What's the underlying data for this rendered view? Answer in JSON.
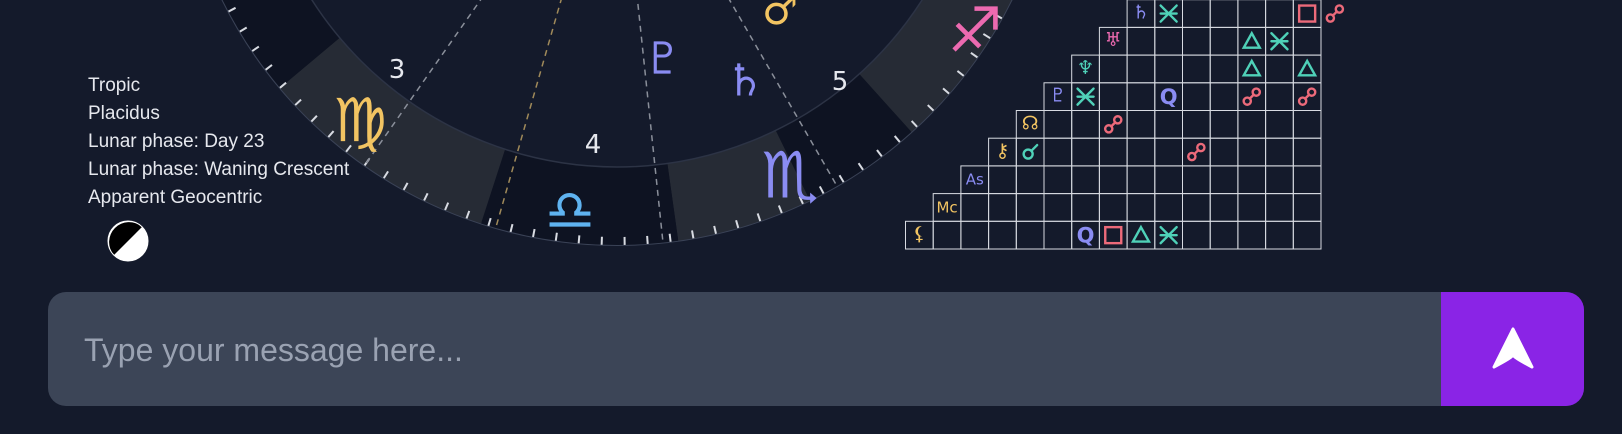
{
  "chart_info": {
    "lines": [
      "Tropic",
      "Placidus",
      "Lunar phase: Day 23",
      "Lunar phase: Waning Crescent",
      "Apparent Geocentric"
    ],
    "moon_phase_icon": "waning-crescent-moon-icon"
  },
  "wheel": {
    "houses": [
      {
        "number": "3",
        "sign": "♍",
        "sign_name": "virgo",
        "color": "#f2c462"
      },
      {
        "number": "4",
        "sign": "♎",
        "sign_name": "libra",
        "color": "#5fb3f0"
      },
      {
        "number": "5",
        "sign": "♏",
        "sign_name": "scorpio",
        "color": "#8a8cf2"
      },
      {
        "number": "",
        "sign": "♐",
        "sign_name": "sagittarius",
        "color": "#ec6ab0"
      }
    ],
    "planets": [
      {
        "glyph": "♇",
        "name": "pluto",
        "color": "#8a8cf2"
      },
      {
        "glyph": "♄",
        "name": "saturn",
        "color": "#8a8cf2"
      },
      {
        "glyph": "♂",
        "name": "mars",
        "color": "#f2c462"
      }
    ]
  },
  "aspect_grid": {
    "rows": [
      {
        "glyph": "♄",
        "color": "#8a8cf2"
      },
      {
        "glyph": "♅",
        "color": "#ec6ab0"
      },
      {
        "glyph": "♆",
        "color": "#4fd1b8"
      },
      {
        "glyph": "♇",
        "color": "#8a8cf2"
      },
      {
        "glyph": "☊",
        "color": "#f2c462"
      },
      {
        "glyph": "⚷",
        "color": "#f2c462"
      },
      {
        "glyph": "As",
        "color": "#8a8cf2"
      },
      {
        "glyph": "Mc",
        "color": "#f2c462"
      },
      {
        "glyph": "⚸",
        "color": "#f2c462"
      }
    ],
    "aspects": [
      {
        "row": 0,
        "col": 1,
        "symbol": "sextile",
        "color": "#4fd1b8"
      },
      {
        "row": 0,
        "col": 6,
        "symbol": "square",
        "color": "#ec6a7a"
      },
      {
        "row": 0,
        "col": 7,
        "symbol": "opposition",
        "color": "#ec6a7a"
      },
      {
        "row": 1,
        "col": 5,
        "symbol": "trine",
        "color": "#4fd1b8"
      },
      {
        "row": 1,
        "col": 6,
        "symbol": "sextile",
        "color": "#4fd1b8"
      },
      {
        "row": 2,
        "col": 6,
        "symbol": "trine",
        "color": "#4fd1b8"
      },
      {
        "row": 2,
        "col": 8,
        "symbol": "trine",
        "color": "#4fd1b8"
      },
      {
        "row": 3,
        "col": 1,
        "symbol": "sextile",
        "color": "#4fd1b8"
      },
      {
        "row": 3,
        "col": 4,
        "symbol": "quintile",
        "color": "#8a8cf2"
      },
      {
        "row": 3,
        "col": 7,
        "symbol": "opposition",
        "color": "#ec6a7a"
      },
      {
        "row": 3,
        "col": 9,
        "symbol": "opposition",
        "color": "#ec6a7a"
      },
      {
        "row": 4,
        "col": 3,
        "symbol": "opposition",
        "color": "#ec6a7a"
      },
      {
        "row": 5,
        "col": 1,
        "symbol": "conjunction",
        "color": "#4fd1b8"
      },
      {
        "row": 5,
        "col": 7,
        "symbol": "opposition",
        "color": "#ec6a7a"
      },
      {
        "row": 8,
        "col": 6,
        "symbol": "quintile",
        "color": "#8a8cf2"
      },
      {
        "row": 8,
        "col": 7,
        "symbol": "square",
        "color": "#ec6a7a"
      },
      {
        "row": 8,
        "col": 8,
        "symbol": "trine",
        "color": "#4fd1b8"
      },
      {
        "row": 8,
        "col": 9,
        "symbol": "sextile",
        "color": "#4fd1b8"
      }
    ]
  },
  "composer": {
    "placeholder": "Type your message here...",
    "value": "",
    "send_icon": "send-arrow-icon"
  },
  "colors": {
    "background": "#141a2b",
    "send_button": "#8a24e6",
    "input_bg": "#3c4557"
  }
}
